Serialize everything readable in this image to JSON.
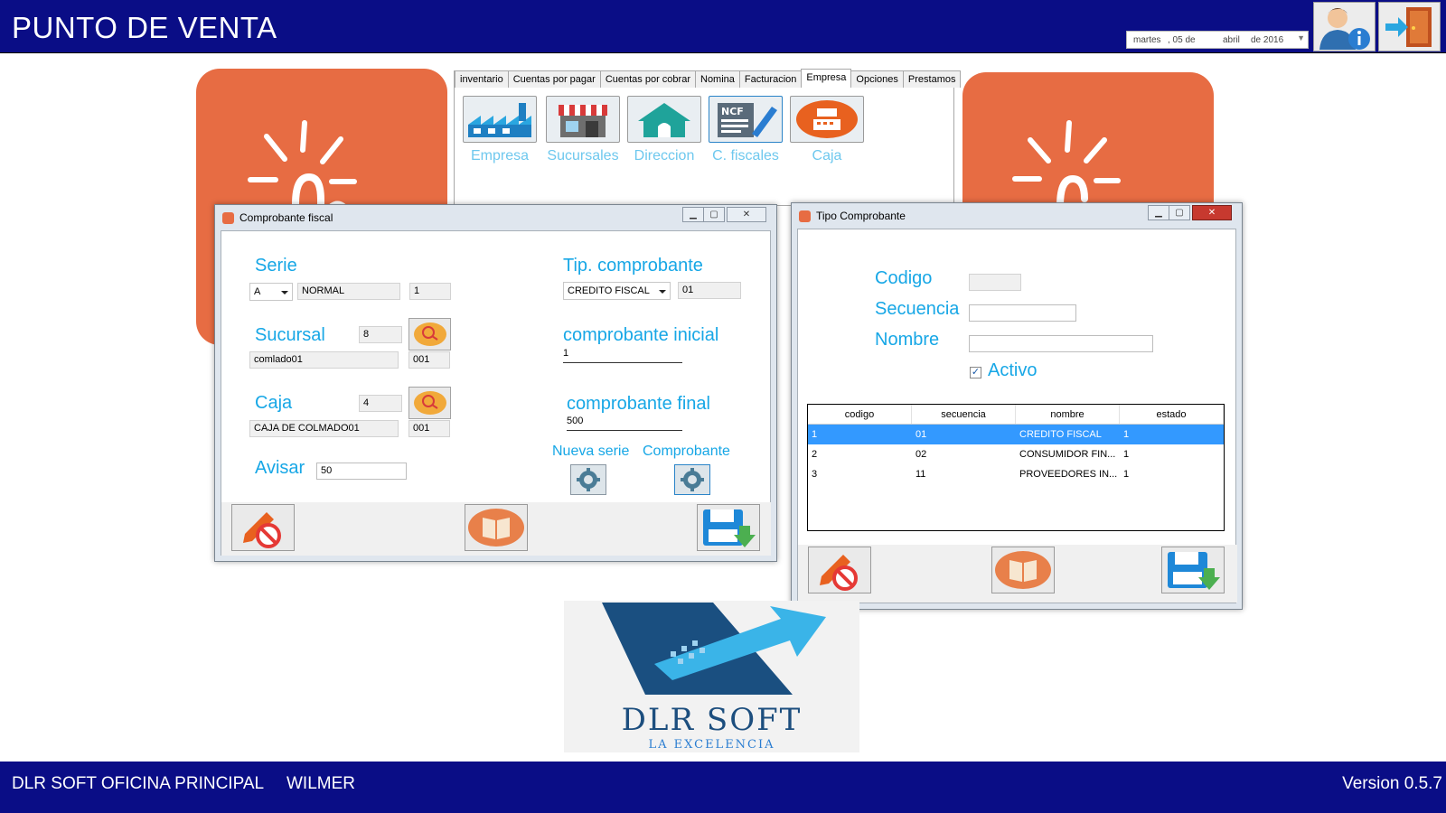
{
  "app": {
    "title": "PUNTO DE VENTA"
  },
  "header": {
    "date": {
      "weekday": "martes",
      "day": ", 05 de",
      "month": "abril",
      "year": "de 2016"
    },
    "user_info_icon": "user-info-icon",
    "exit_icon": "exit-door-icon"
  },
  "ribbon": {
    "tabs": [
      "inventario",
      "Cuentas por pagar",
      "Cuentas por cobrar",
      "Nomina",
      "Facturacion",
      "Empresa",
      "Opciones",
      "Prestamos"
    ],
    "active_tab": "Empresa",
    "items": [
      {
        "label": "Empresa",
        "icon": "factory-icon"
      },
      {
        "label": "Sucursales",
        "icon": "store-icon"
      },
      {
        "label": "Direccion",
        "icon": "home-icon"
      },
      {
        "label": "C. fiscales",
        "icon": "ncf-document-icon"
      },
      {
        "label": "Caja",
        "icon": "cash-register-icon"
      }
    ]
  },
  "comprobante_window": {
    "title": "Comprobante fiscal",
    "serie_label": "Serie",
    "serie_value": "A",
    "serie_type": "NORMAL",
    "serie_num": "1",
    "sucursal_label": "Sucursal",
    "sucursal_id": "8",
    "sucursal_name": "comlado01",
    "sucursal_code": "001",
    "caja_label": "Caja",
    "caja_id": "4",
    "caja_name": "CAJA DE COLMADO01",
    "caja_code": "001",
    "avisar_label": "Avisar",
    "avisar_value": "50",
    "tip_label": "Tip. comprobante",
    "tip_value": "CREDITO FISCAL",
    "tip_code": "01",
    "inicial_label": "comprobante inicial",
    "inicial_value": "1",
    "final_label": "comprobante final",
    "final_value": "500",
    "nueva_serie_label": "Nueva serie",
    "comprobante_label": "Comprobante"
  },
  "tipo_window": {
    "title": "Tipo Comprobante",
    "codigo_label": "Codigo",
    "codigo_value": "",
    "secuencia_label": "Secuencia",
    "secuencia_value": "",
    "nombre_label": "Nombre",
    "nombre_value": "",
    "activo_label": "Activo",
    "activo_checked": true,
    "grid": {
      "columns": [
        "codigo",
        "secuencia",
        "nombre",
        "estado"
      ],
      "rows": [
        [
          "1",
          "01",
          "CREDITO FISCAL",
          "1"
        ],
        [
          "2",
          "02",
          "CONSUMIDOR FIN...",
          "1"
        ],
        [
          "3",
          "11",
          "PROVEEDORES IN...",
          "1"
        ]
      ],
      "selected_row": 0
    }
  },
  "logo": {
    "name": "DLR SOFT",
    "tagline": "LA EXCELENCIA"
  },
  "status": {
    "office": "DLR SOFT OFICINA PRINCIPAL",
    "user": "WILMER",
    "version": "Version 0.5.7"
  },
  "colors": {
    "bar": "#0a0d86",
    "accent": "#17a7e6",
    "tile": "#e76c43",
    "selection": "#3399ff"
  }
}
